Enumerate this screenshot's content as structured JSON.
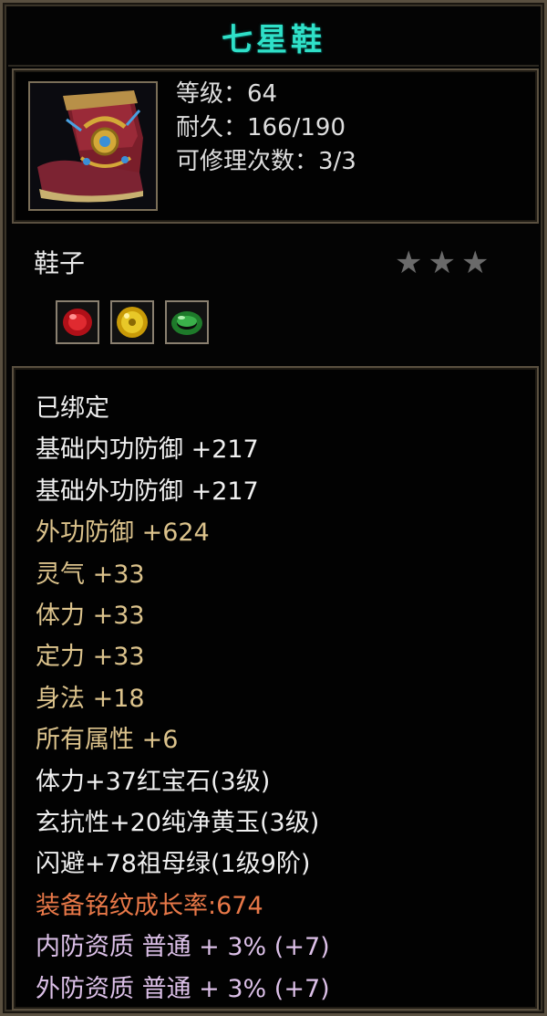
{
  "item": {
    "name": "七星鞋",
    "icon": "boot-icon",
    "level": "等级：64",
    "durability": "耐久：166/190",
    "repair_count": "可修理次数：3/3",
    "type": "鞋子",
    "stars_filled": 0,
    "stars_total": 3
  },
  "gems": [
    {
      "name": "ruby-gem-icon",
      "color": "#c8181c"
    },
    {
      "name": "yellow-jade-gem-icon",
      "color": "#d4b010"
    },
    {
      "name": "emerald-gem-icon",
      "color": "#2e9a3a"
    }
  ],
  "stats": [
    {
      "text": "已绑定",
      "color": "white"
    },
    {
      "text": "基础内功防御 +217",
      "color": "white"
    },
    {
      "text": "基础外功防御 +217",
      "color": "white"
    },
    {
      "text": "外功防御 +624",
      "color": "tan"
    },
    {
      "text": "灵气 +33",
      "color": "tan"
    },
    {
      "text": "体力 +33",
      "color": "tan"
    },
    {
      "text": "定力 +33",
      "color": "tan"
    },
    {
      "text": "身法 +18",
      "color": "tan"
    },
    {
      "text": "所有属性 +6",
      "color": "tan"
    },
    {
      "text": "体力+37红宝石(3级)",
      "color": "white"
    },
    {
      "text": "玄抗性+20纯净黄玉(3级)",
      "color": "white"
    },
    {
      "text": "闪避+78祖母绿(1级9阶)",
      "color": "white"
    },
    {
      "text": "装备铭纹成长率:674",
      "color": "orange"
    },
    {
      "text": "内防资质 普通 + 3% (+7)",
      "color": "pink"
    },
    {
      "text": "外防资质 普通 + 3% (+7)",
      "color": "pink"
    }
  ],
  "colors": {
    "title": "#2fe0c8",
    "white": "#f0f0f0",
    "tan": "#dcc38c",
    "orange": "#e87848",
    "pink": "#dcc0e8",
    "border": "#5a5040"
  }
}
